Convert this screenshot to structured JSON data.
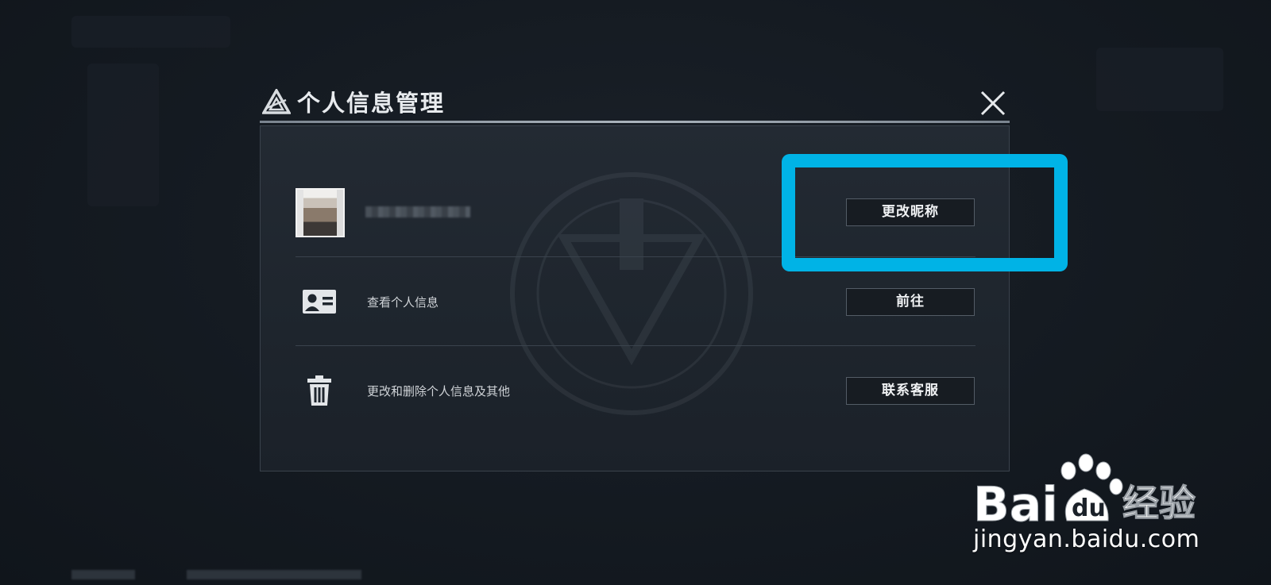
{
  "dialog": {
    "title": "个人信息管理",
    "close_icon": "close-icon"
  },
  "profile": {
    "nickname": "",
    "change_nickname_label": "更改昵称"
  },
  "rows": [
    {
      "icon": "id-card-icon",
      "label": "查看个人信息",
      "button": "前往"
    },
    {
      "icon": "trash-icon",
      "label": "更改和删除个人信息及其他",
      "button": "联系客服"
    }
  ],
  "watermark": {
    "brand_left": "Bai",
    "brand_mid": "du",
    "brand_right": "经验",
    "url": "jingyan.baidu.com"
  },
  "colors": {
    "highlight": "#00b3e6",
    "background": "#141a21",
    "dialog": "#1f262e"
  }
}
